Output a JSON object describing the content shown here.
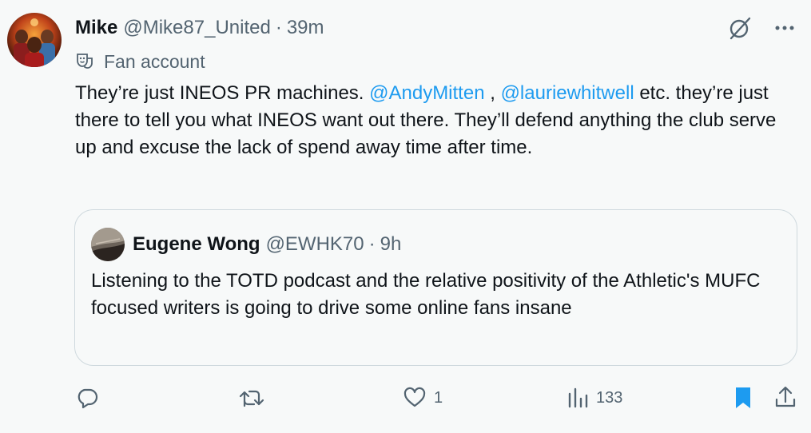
{
  "tweet": {
    "author_name": "Mike",
    "author_handle": "@Mike87_United",
    "separator": "·",
    "time": "39m",
    "label_icon": "theater-masks-icon",
    "label": "Fan account",
    "text_part1": "They’re just INEOS PR machines. ",
    "mention1": "@AndyMitten",
    "text_part2": " , ",
    "mention2": "@lauriewhitwell",
    "text_part3": " etc. they’re just there to tell you what INEOS want out there. They’ll defend anything the club serve up and excuse the lack of spend away time after time."
  },
  "quote": {
    "author_name": "Eugene Wong",
    "author_handle": "@EWHK70",
    "separator": "·",
    "time": "9h",
    "text": "Listening to the TOTD podcast and the relative positivity of the Athletic's MUFC focused writers is going to drive some online fans insane"
  },
  "actions": {
    "reply_icon": "reply-icon",
    "retweet_icon": "retweet-icon",
    "like_icon": "heart-icon",
    "like_count": "1",
    "views_icon": "views-icon",
    "views_count": "133",
    "bookmark_icon": "bookmark-filled-icon",
    "share_icon": "share-icon"
  },
  "colors": {
    "background": "#f7f9f9",
    "text": "#0f1419",
    "secondary": "#536471",
    "link": "#1d9bf0",
    "border": "#cfd9de"
  }
}
